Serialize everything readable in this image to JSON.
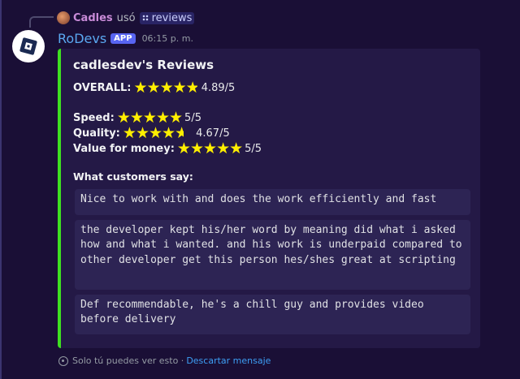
{
  "reply": {
    "user": "Cadles",
    "verb": "usó",
    "command": "reviews"
  },
  "message": {
    "author": "RoDevs",
    "badge": "APP",
    "time": "06:15 p. m."
  },
  "embed": {
    "accent_color": "#3ee021",
    "title": "cadlesdev's Reviews",
    "overall": {
      "label": "OVERALL:",
      "rating": 4.89,
      "text": "4.89/5"
    },
    "ratings": [
      {
        "label": "Speed:",
        "rating": 5,
        "text": "5/5"
      },
      {
        "label": "Quality:",
        "rating": 4.67,
        "text": "4.67/5"
      },
      {
        "label": "Value for money:",
        "rating": 5,
        "text": "5/5"
      }
    ],
    "customers_heading": "What customers say:",
    "reviews": [
      "Nice to work with and does the work efficiently and fast",
      "the developer kept his/her word by meaning did what i asked how and what i wanted. and his work is underpaid compared to other developer get this person hes/shes great at scripting",
      "Def recommendable, he's a chill guy and provides video before delivery"
    ]
  },
  "footer": {
    "note": "Solo tú puedes ver esto ·",
    "dismiss": "Descartar mensaje"
  }
}
